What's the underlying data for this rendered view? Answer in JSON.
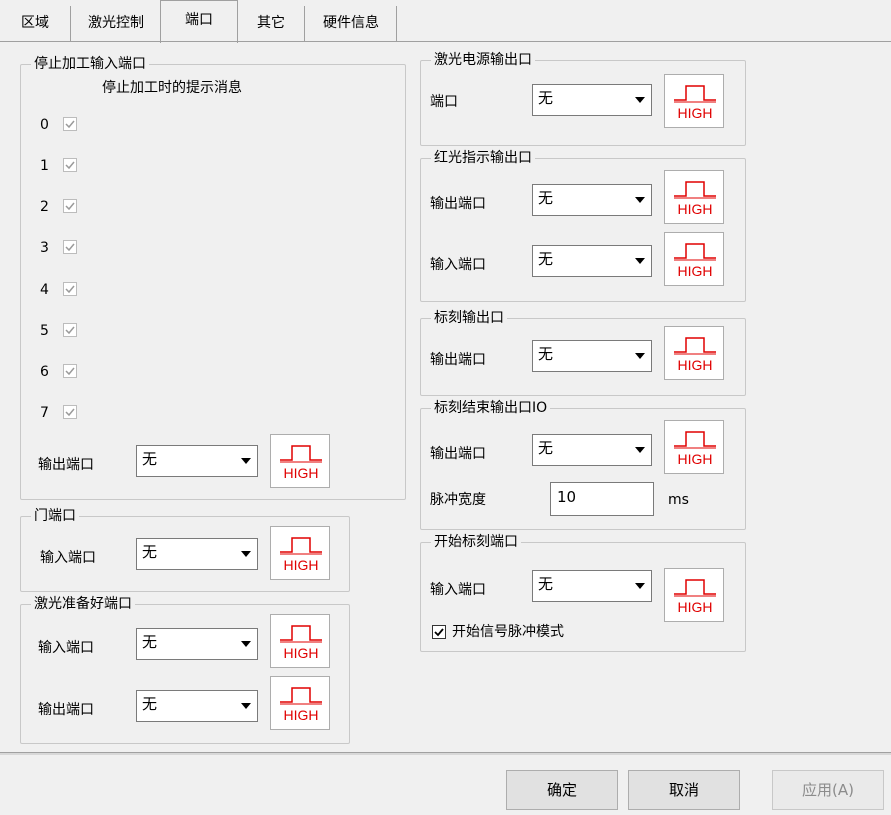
{
  "tabs": [
    "区域",
    "激光控制",
    "端口",
    "其它",
    "硬件信息"
  ],
  "stop_input": {
    "title": "停止加工输入端口",
    "subtitle": "停止加工时的提示消息",
    "items": [
      "0",
      "1",
      "2",
      "3",
      "4",
      "5",
      "6",
      "7"
    ],
    "output_label": "输出端口",
    "output_value": "无"
  },
  "door": {
    "title": "门端口",
    "input_label": "输入端口",
    "input_value": "无"
  },
  "laser_ready": {
    "title": "激光准备好端口",
    "input_label": "输入端口",
    "input_value": "无",
    "output_label": "输出端口",
    "output_value": "无"
  },
  "laser_power": {
    "title": "激光电源输出口",
    "port_label": "端口",
    "port_value": "无"
  },
  "red_light": {
    "title": "红光指示输出口",
    "output_label": "输出端口",
    "output_value": "无",
    "input_label": "输入端口",
    "input_value": "无"
  },
  "mark_output": {
    "title": "标刻输出口",
    "output_label": "输出端口",
    "output_value": "无"
  },
  "mark_end": {
    "title": "标刻结束输出口IO",
    "output_label": "输出端口",
    "output_value": "无",
    "pulse_label": "脉冲宽度",
    "pulse_value": "10",
    "pulse_unit": "ms"
  },
  "mark_start": {
    "title": "开始标刻端口",
    "input_label": "输入端口",
    "input_value": "无",
    "pulse_mode_label": "开始信号脉冲模式"
  },
  "high_label": "HIGH",
  "buttons": {
    "ok": "确定",
    "cancel": "取消",
    "apply": "应用(A)"
  },
  "colors": {
    "high_red": "#e00000"
  }
}
